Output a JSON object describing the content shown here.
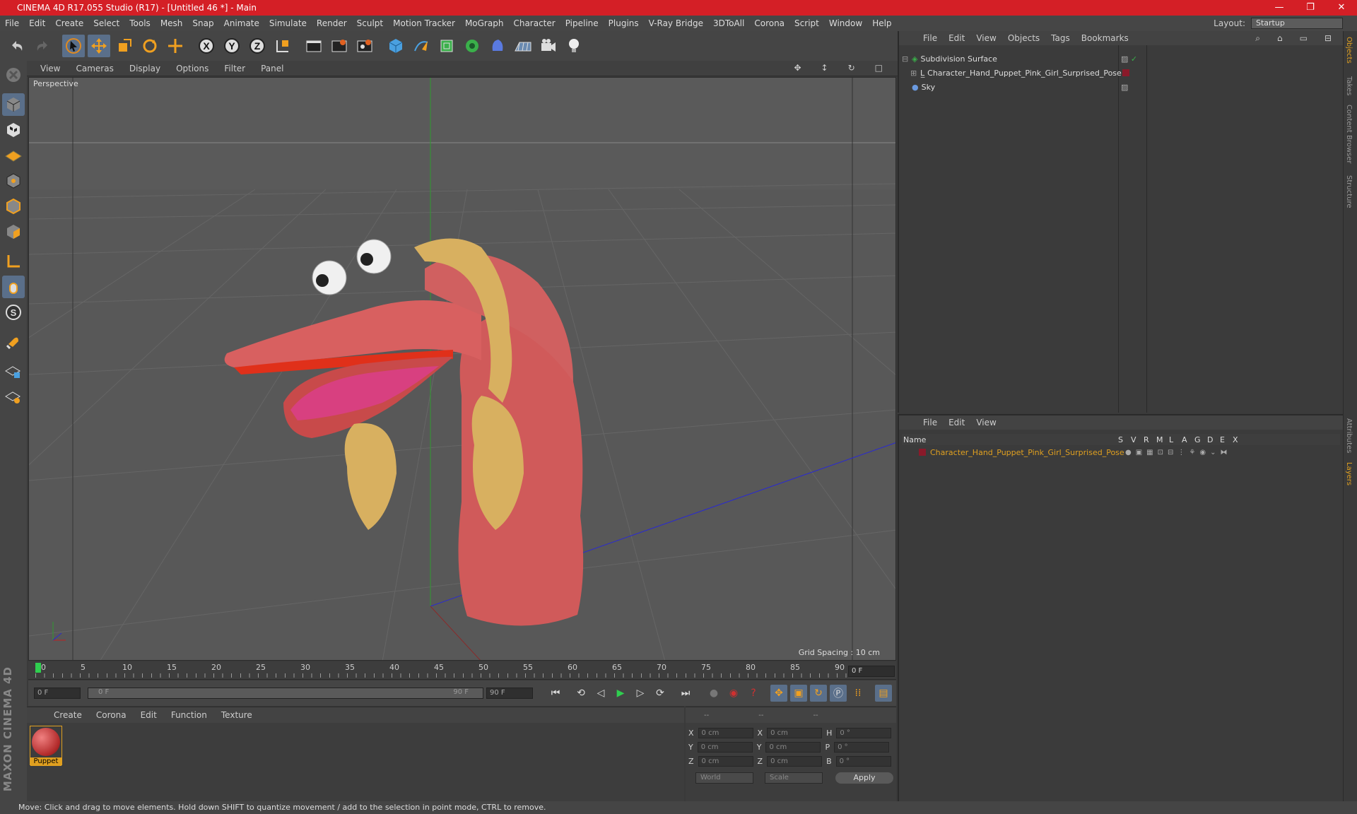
{
  "window": {
    "title": "CINEMA 4D R17.055 Studio (R17) - [Untitled 46 *] - Main",
    "minimize": "—",
    "restore": "❐",
    "close": "✕"
  },
  "menu": [
    "File",
    "Edit",
    "Create",
    "Select",
    "Tools",
    "Mesh",
    "Snap",
    "Animate",
    "Simulate",
    "Render",
    "Sculpt",
    "Motion Tracker",
    "MoGraph",
    "Character",
    "Pipeline",
    "Plugins",
    "V-Ray Bridge",
    "3DToAll",
    "Corona",
    "Script",
    "Window",
    "Help"
  ],
  "layout": {
    "label": "Layout:",
    "value": "Startup"
  },
  "viewport": {
    "menu": [
      "View",
      "Cameras",
      "Display",
      "Options",
      "Filter",
      "Panel"
    ],
    "camera_label": "Perspective",
    "grid_spacing": "Grid Spacing : 10 cm"
  },
  "timeline": {
    "ticks": [
      "0",
      "5",
      "10",
      "15",
      "20",
      "25",
      "30",
      "35",
      "40",
      "45",
      "50",
      "55",
      "60",
      "65",
      "70",
      "75",
      "80",
      "85",
      "90"
    ],
    "current_frame": "0 F",
    "start_field": "0 F",
    "range_start": "0 F",
    "range_end": "90 F",
    "end_field": "90 F"
  },
  "material_manager": {
    "menu": [
      "Create",
      "Corona",
      "Edit",
      "Function",
      "Texture"
    ],
    "materials": [
      {
        "name": "Puppet"
      }
    ]
  },
  "coordinates": {
    "header": [
      "--",
      "--",
      "--"
    ],
    "rows": [
      {
        "a": "X",
        "av": "0 cm",
        "b": "X",
        "bv": "0 cm",
        "c": "H",
        "cv": "0 °"
      },
      {
        "a": "Y",
        "av": "0 cm",
        "b": "Y",
        "bv": "0 cm",
        "c": "P",
        "cv": "0 °"
      },
      {
        "a": "Z",
        "av": "0 cm",
        "b": "Z",
        "bv": "0 cm",
        "c": "B",
        "cv": "0 °"
      }
    ],
    "mode1": "World",
    "mode2": "Scale",
    "apply": "Apply"
  },
  "object_manager": {
    "menu": [
      "File",
      "Edit",
      "View",
      "Objects",
      "Tags",
      "Bookmarks"
    ],
    "objects": [
      {
        "name": "Subdivision Surface"
      },
      {
        "name": "Character_Hand_Puppet_Pink_Girl_Surprised_Pose"
      },
      {
        "name": "Sky"
      }
    ]
  },
  "layer_manager": {
    "menu": [
      "File",
      "Edit",
      "View"
    ],
    "columns": [
      "Name",
      "S",
      "V",
      "R",
      "M",
      "L",
      "A",
      "G",
      "D",
      "E",
      "X"
    ],
    "layers": [
      {
        "name": "Character_Hand_Puppet_Pink_Girl_Surprised_Pose",
        "color": "#8a1a2a"
      }
    ]
  },
  "right_tabs": [
    "Objects",
    "Takes",
    "Content Browser",
    "Structure",
    "Attributes",
    "Layers"
  ],
  "branding": "MAXON CINEMA 4D",
  "status": "Move: Click and drag to move elements. Hold down SHIFT to quantize movement / add to the selection in point mode, CTRL to remove.",
  "colors": {
    "accent": "#d41f26",
    "selection": "#e0a020",
    "puppet": "#d85a5a"
  }
}
